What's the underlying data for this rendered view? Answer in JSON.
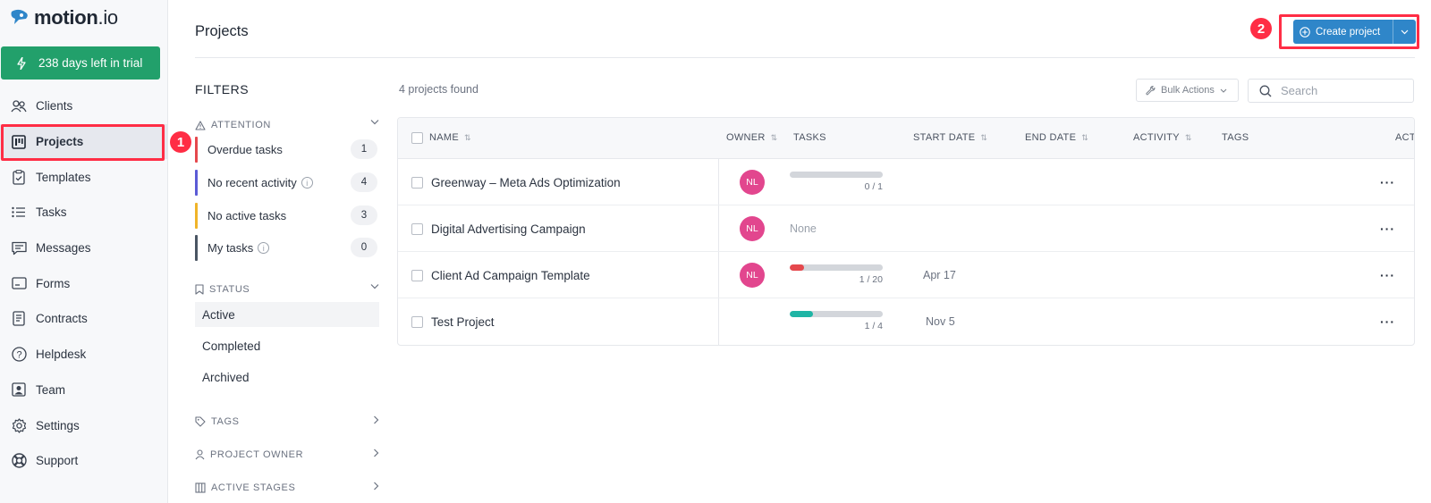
{
  "brand": {
    "name_bold": "motion",
    "name_light": ".io"
  },
  "trial": {
    "label": "238 days left in trial"
  },
  "nav": {
    "items": [
      {
        "label": "Clients"
      },
      {
        "label": "Projects"
      },
      {
        "label": "Templates"
      },
      {
        "label": "Tasks"
      },
      {
        "label": "Messages"
      },
      {
        "label": "Forms"
      },
      {
        "label": "Contracts"
      },
      {
        "label": "Helpdesk"
      },
      {
        "label": "Team"
      },
      {
        "label": "Settings"
      },
      {
        "label": "Support"
      }
    ]
  },
  "annotations": {
    "one": "1",
    "two": "2"
  },
  "header": {
    "title": "Projects",
    "create_label": "Create project"
  },
  "filters": {
    "title": "FILTERS",
    "attention": {
      "label": "ATTENTION",
      "items": [
        {
          "label": "Overdue tasks",
          "count": "1",
          "color": "#e5484d"
        },
        {
          "label": "No recent activity",
          "count": "4",
          "color": "#5b5bd6"
        },
        {
          "label": "No active tasks",
          "count": "3",
          "color": "#f0b429"
        },
        {
          "label": "My tasks",
          "count": "0",
          "color": "#4a5563"
        }
      ]
    },
    "status": {
      "label": "STATUS",
      "items": [
        {
          "label": "Active"
        },
        {
          "label": "Completed"
        },
        {
          "label": "Archived"
        }
      ]
    },
    "tags_label": "TAGS",
    "owner_label": "PROJECT OWNER",
    "stages_label": "ACTIVE STAGES"
  },
  "toolbar": {
    "found": "4 projects found",
    "bulk_label": "Bulk Actions",
    "search_placeholder": "Search"
  },
  "table": {
    "columns": {
      "name": "NAME",
      "owner": "OWNER",
      "tasks": "TASKS",
      "start": "START DATE",
      "end": "END DATE",
      "activity": "ACTIVITY",
      "tags": "TAGS",
      "actions": "ACTIONS"
    },
    "rows": [
      {
        "name": "Greenway – Meta Ads Optimization",
        "owner": "NL",
        "tasks": "0 / 1",
        "progress": 0,
        "start": ""
      },
      {
        "name": "Digital Advertising Campaign",
        "owner": "NL",
        "tasks_none": "None",
        "start": ""
      },
      {
        "name": "Client Ad Campaign Template",
        "owner": "NL",
        "tasks": "1 / 20",
        "progress": 0.05,
        "start": "Apr 17"
      },
      {
        "name": "Test Project",
        "owner": "",
        "tasks": "1 / 4",
        "progress": 0.25,
        "start": "Nov 5"
      }
    ]
  },
  "colors": {
    "primary": "#2f86c9",
    "trial": "#22a06b",
    "avatar": "#e2468e",
    "highlight": "#ff2d45",
    "progress_red": "#e5484d",
    "progress_teal": "#1fb5a5"
  }
}
